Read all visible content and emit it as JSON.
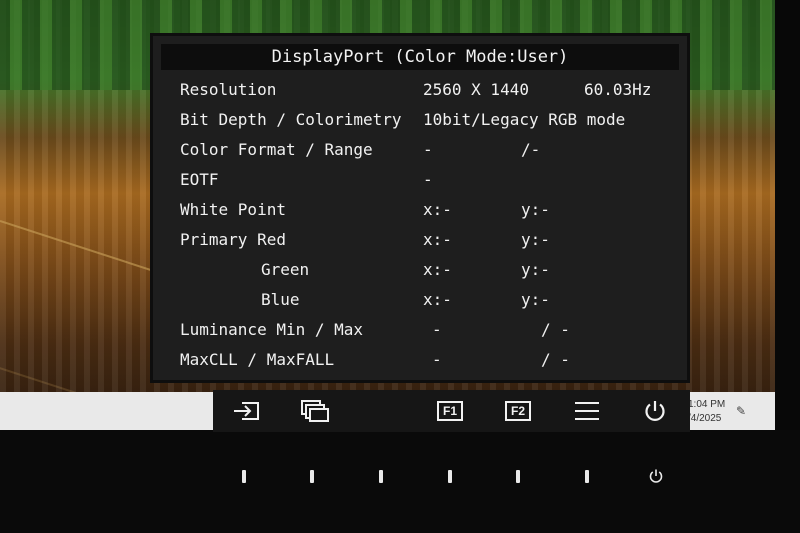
{
  "osd": {
    "title": "DisplayPort (Color Mode:User)",
    "rows": [
      {
        "label": "Resolution",
        "v1": "2560 X 1440",
        "v2": "60.03Hz"
      },
      {
        "label": "Bit Depth / Colorimetry",
        "v1": "10bit/Legacy RGB mode",
        "v2": ""
      },
      {
        "label": "Color Format / Range",
        "v1": "-",
        "v2": "/-"
      },
      {
        "label": "EOTF",
        "v1": "-",
        "v2": ""
      },
      {
        "label": "White Point",
        "v1": "x:-",
        "v2": "y:-"
      },
      {
        "label": "Primary Red",
        "v1": "x:-",
        "v2": "y:-"
      },
      {
        "label": "Green",
        "v1": "x:-",
        "v2": "y:-"
      },
      {
        "label": "Blue",
        "v1": "x:-",
        "v2": "y:-"
      },
      {
        "label": "Luminance Min / Max",
        "v1": "-",
        "v2": "/ -"
      },
      {
        "label": "MaxCLL / MaxFALL",
        "v1": "-",
        "v2": "/ -"
      }
    ]
  },
  "buttons": {
    "input_icon": "input-select-icon",
    "picture_icon": "picture-mode-icon",
    "f1_label": "F1",
    "f2_label": "F2",
    "menu_icon": "menu-icon",
    "power_icon": "power-icon"
  },
  "taskbar": {
    "time": "1:04 PM",
    "date": "/4/2025"
  },
  "colors": {
    "osd_background": "#1e1e1e",
    "osd_text": "#f1f1f1",
    "title_background": "#0d0d0d"
  }
}
